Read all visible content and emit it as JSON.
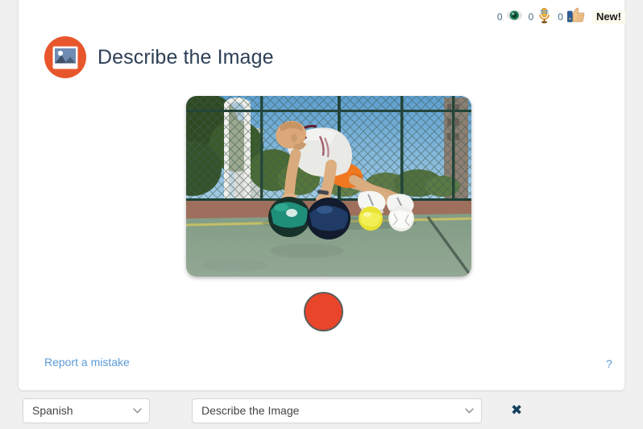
{
  "stats": {
    "items": [
      {
        "count": "0",
        "icon": "eye-icon",
        "name": "views-stat"
      },
      {
        "count": "0",
        "icon": "microphone-icon",
        "name": "recordings-stat"
      },
      {
        "count": "0",
        "icon": "thumbs-up-icon",
        "name": "likes-stat"
      }
    ],
    "new_badge": "New!"
  },
  "header": {
    "title": "Describe the Image",
    "icon": "image-badge-icon"
  },
  "main": {
    "photo_alt": "Man doing push-ups with hands on two medicine balls and feet on two balls on an outdoor basketball court",
    "record_button_label": "",
    "record_button_color": "#e8452a"
  },
  "footer": {
    "report_link": "Report a mistake",
    "help_icon_label": "?"
  },
  "toolbar": {
    "language": {
      "selected": "Spanish",
      "options": [
        "Spanish"
      ]
    },
    "activity": {
      "selected": "Describe the Image",
      "options": [
        "Describe the Image"
      ]
    },
    "close_label": "✖"
  },
  "colors": {
    "accent_orange": "#e8562c",
    "record_red": "#e8452a",
    "title_navy": "#2e4057",
    "link_blue": "#5b9bd5",
    "page_bg": "#f0f0f0",
    "card_bg": "#ffffff",
    "badge_bg": "#fcfbef"
  }
}
